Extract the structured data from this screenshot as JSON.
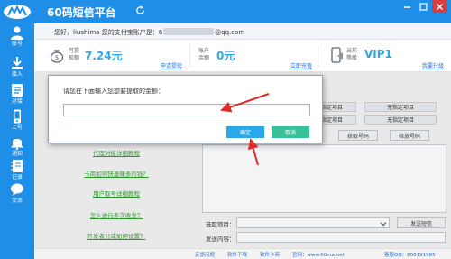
{
  "app": {
    "title": "60码短信平台"
  },
  "sidebar": {
    "items": [
      {
        "label": "账号",
        "icon": "user-icon"
      },
      {
        "label": "接入",
        "icon": "download-icon"
      },
      {
        "label": "对接",
        "icon": "document-icon"
      },
      {
        "label": "上号",
        "icon": "phone-icon"
      },
      {
        "label": "通知",
        "icon": "bell-icon"
      },
      {
        "label": "记录",
        "icon": "notebook-icon"
      },
      {
        "label": "交流",
        "icon": "chat-icon"
      }
    ]
  },
  "greeting": {
    "prefix": "您好，",
    "username": "liushima",
    "account_label": "您的支付宝账户是：",
    "account_start": "6",
    "account_end": "@qq.com"
  },
  "stats": {
    "balance_label_1": "可提",
    "balance_label_2": "现额",
    "balance_value": "7.24元",
    "withdraw_link": "申请提现",
    "account_label_1": "账户",
    "account_label_2": "余额",
    "account_value": "0元",
    "recharge_link": "立即充值",
    "level_label_1": "当前",
    "level_label_2": "等级",
    "level_value": "VIP1",
    "upgrade_link": "我要升级"
  },
  "project_buttons": [
    "无指定项目",
    "无指定项目",
    "无指定项目",
    "无指定项目"
  ],
  "actions": {
    "get_number": "获取号码",
    "release_number": "释放号码"
  },
  "help_links": [
    "代理对接详细教程",
    "卡商如何快速赚多的钱？",
    "用户取号详细教程",
    "怎么进行多次收发？",
    "开发者分成如何设置？"
  ],
  "form": {
    "select_label": "选取项目：",
    "send_button": "发送短信",
    "content_label": "发送内容："
  },
  "footer": {
    "links": [
      "反馈问题",
      "软件下载",
      "软件卡商",
      "官网：www.60ma.net"
    ],
    "qq": "客服QQ：800191985"
  },
  "dialog": {
    "prompt": "请您在下面输入您想要提取的金额：",
    "input_value": "",
    "ok_label": "确定",
    "cancel_label": "取消"
  },
  "colors": {
    "primary": "#1f8ee6",
    "value": "#31a8e6",
    "link_green": "#2a9a2a",
    "ok_button": "#29a8ea",
    "cancel_button": "#39c29a",
    "arrow": "#e02a2a"
  }
}
